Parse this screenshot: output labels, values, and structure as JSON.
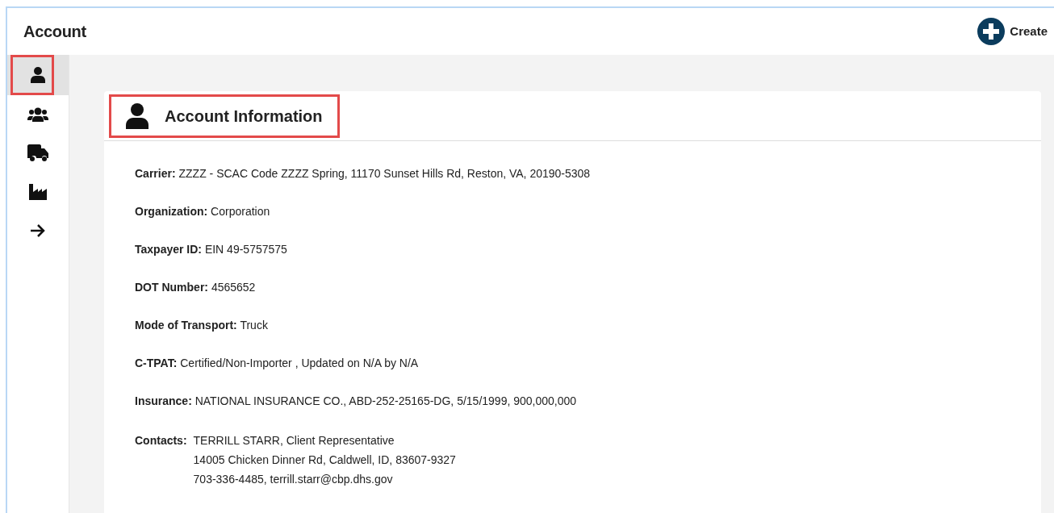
{
  "page": {
    "title": "Account"
  },
  "create_button": {
    "label": "Create"
  },
  "sidebar": {
    "items": [
      {
        "kind": "person",
        "selected": true,
        "highlighted": true
      },
      {
        "kind": "group",
        "selected": false,
        "highlighted": false
      },
      {
        "kind": "truck",
        "selected": false,
        "highlighted": false
      },
      {
        "kind": "factory",
        "selected": false,
        "highlighted": false
      },
      {
        "kind": "arrow",
        "selected": false,
        "highlighted": false
      }
    ]
  },
  "card": {
    "title": "Account Information",
    "highlighted": true,
    "fields": [
      {
        "label": "Carrier:",
        "value": "ZZZZ - SCAC Code ZZZZ Spring, 11170 Sunset Hills Rd, Reston, VA, 20190-5308"
      },
      {
        "label": "Organization:",
        "value": "Corporation"
      },
      {
        "label": "Taxpayer ID:",
        "value": "EIN 49-5757575"
      },
      {
        "label": "DOT Number:",
        "value": "4565652"
      },
      {
        "label": "Mode of Transport:",
        "value": "Truck"
      },
      {
        "label": "C-TPAT:",
        "value": "Certified/Non-Importer , Updated on N/A by N/A"
      },
      {
        "label": "Insurance:",
        "value": "NATIONAL INSURANCE CO., ABD-252-25165-DG, 5/15/1999, 900,000,000"
      }
    ],
    "contacts": {
      "label": "Contacts:",
      "lines": [
        "TERRILL STARR, Client Representative",
        "14005 Chicken Dinner Rd, Caldwell, ID, 83607-9327",
        "703-336-4485, terrill.starr@cbp.dhs.gov"
      ]
    }
  }
}
